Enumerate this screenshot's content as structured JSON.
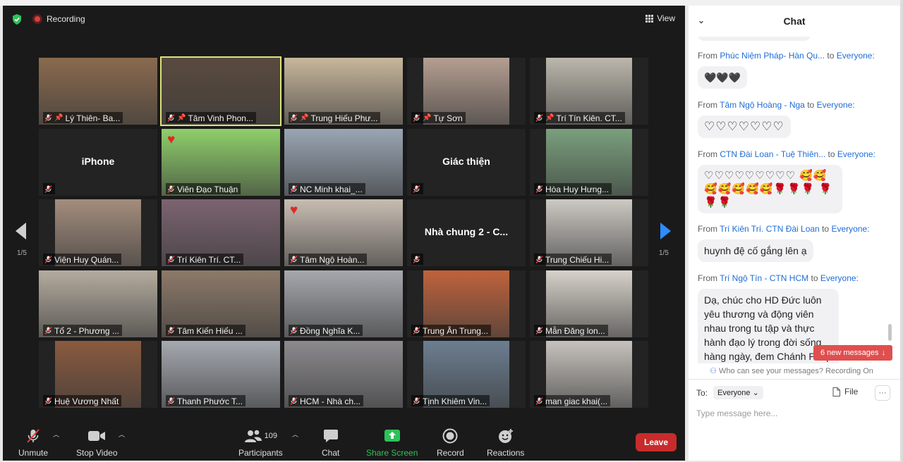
{
  "topbar": {
    "recording_label": "Recording",
    "view_label": "View"
  },
  "grid": {
    "page_left": "1/5",
    "page_right": "1/5",
    "tiles": [
      {
        "name": "Lý Thiên- Ba...",
        "pinned": true,
        "photo": "#8a6a4e"
      },
      {
        "name": "Tâm Vinh Phon...",
        "pinned": true,
        "photo": "#5a4a3e",
        "active": true
      },
      {
        "name": "Trung Hiếu Phư...",
        "pinned": true,
        "photo": "#c8b79c"
      },
      {
        "name": "Tự Sơn",
        "pinned": true,
        "photo": "#b59e91"
      },
      {
        "name": "Trí Tín Kiên. CT...",
        "pinned": true,
        "photo": "#bcb7ac"
      },
      {
        "name": "",
        "label": "iPhone"
      },
      {
        "name": "Viên Đạo Thuận",
        "photo": "#8fd06a",
        "heart": true
      },
      {
        "name": "NC Minh khai_...",
        "photo": "#9aa6b4"
      },
      {
        "name": "",
        "label": "Giác thiện"
      },
      {
        "name": "Hòa Huy Hưng...",
        "photo": "#7aa07d"
      },
      {
        "name": "Viện Huy Quán...",
        "photo": "#a48d7d"
      },
      {
        "name": "Trí Kiên Trí. CT...",
        "photo": "#7c6470"
      },
      {
        "name": "Tâm Ngộ Hoàn...",
        "photo": "#c8bdb2",
        "heart": true
      },
      {
        "name": "",
        "label": "Nhà chung 2 - C..."
      },
      {
        "name": "Trung Chiếu Hi...",
        "photo": "#cdc9c3"
      },
      {
        "name": "Tổ 2 - Phương ...",
        "photo": "#b4ac9e"
      },
      {
        "name": "Tâm Kiến Hiếu ...",
        "photo": "#8d7a6a"
      },
      {
        "name": "Đồng Nghĩa K...",
        "photo": "#a7a8ae"
      },
      {
        "name": "Trung Ân Trung...",
        "photo": "#c0633c"
      },
      {
        "name": "Mẫn Đăng lon...",
        "photo": "#d7d2ca"
      },
      {
        "name": "Huệ Vương Nhất",
        "photo": "#8a5a3e"
      },
      {
        "name": "Thanh Phước T...",
        "photo": "#a5a9b0"
      },
      {
        "name": "HCM - Nhà ch...",
        "photo": "#8c8a8e"
      },
      {
        "name": "Tịnh Khiêm Vin...",
        "photo": "#6c7e91"
      },
      {
        "name": "man giac khai(...",
        "photo": "#c7c2bd"
      }
    ]
  },
  "toolbar": {
    "unmute": "Unmute",
    "stop_video": "Stop Video",
    "participants": "Participants",
    "participant_count": "109",
    "chat": "Chat",
    "share_screen": "Share Screen",
    "record": "Record",
    "reactions": "Reactions",
    "leave": "Leave"
  },
  "chat": {
    "title": "Chat",
    "messages": [
      {
        "from_word": "From",
        "sender": "Phúc Niệm Pháp- Hàn Qu...",
        "to_word": "to",
        "recipient": "Everyone:",
        "text": "🖤🖤🖤"
      },
      {
        "from_word": "From",
        "sender": "Tâm Ngộ Hoàng - Nga",
        "to_word": "to",
        "recipient": "Everyone:",
        "text": "♡♡♡♡♡♡♡"
      },
      {
        "from_word": "From",
        "sender": "CTN Đài Loan - Tuệ Thiên...",
        "to_word": "to",
        "recipient": "Everyone:",
        "text": "♡♡♡♡♡♡♡♡♡ 🥰🥰🥰🥰🥰🥰🥰🌹🌹🌹 🌹🌹🌹"
      },
      {
        "from_word": "From",
        "sender": "Trí Kiên Trí. CTN Đài Loan",
        "to_word": "to",
        "recipient": "Everyone:",
        "text": "huynh đệ cố gắng lên ạ"
      },
      {
        "from_word": "From",
        "sender": "Trí Ngộ Tín - CTN HCM",
        "to_word": "to",
        "recipient": "Everyone:",
        "text": "Dạ, chúc cho HD Đức luôn yêu thương và động viên nhau trong tu tập và thực hành đạo lý trong đời sống hàng ngày, đem Chánh Pháp"
      }
    ],
    "new_messages": "6 new messages",
    "visibility_note": "Who can see your messages? Recording On",
    "to_label": "To:",
    "to_value": "Everyone",
    "file_label": "File",
    "more_label": "···",
    "input_placeholder": "Type message here..."
  }
}
